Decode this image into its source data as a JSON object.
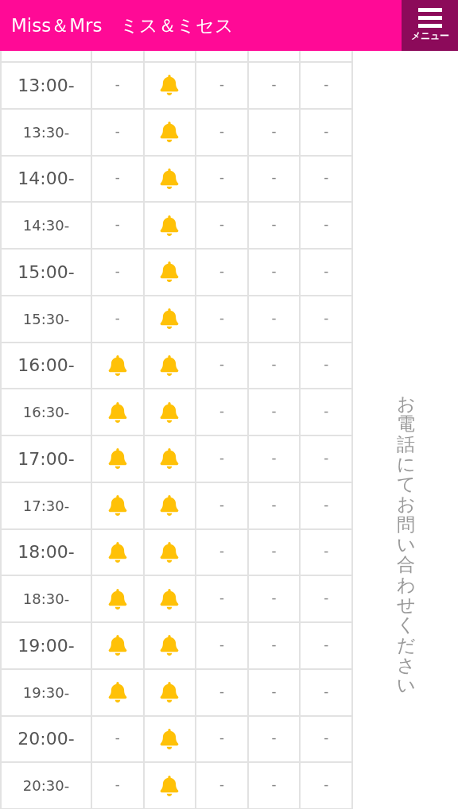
{
  "header": {
    "title": "Miss＆Mrs　ミス＆ミセス",
    "menu_label": "メニュー"
  },
  "schedule": {
    "note": "お電話にてお問い合わせください",
    "rows": [
      {
        "time": "13:00-",
        "kind": "hour",
        "cells": [
          {
            "kind": "dash",
            "text": "-"
          },
          {
            "kind": "bell"
          },
          {
            "kind": "dash",
            "text": "-"
          },
          {
            "kind": "dash",
            "text": "-"
          },
          {
            "kind": "dash",
            "text": "-"
          }
        ]
      },
      {
        "time": "13:30-",
        "kind": "half",
        "cells": [
          {
            "kind": "dash",
            "text": "-"
          },
          {
            "kind": "bell"
          },
          {
            "kind": "dash",
            "text": "-"
          },
          {
            "kind": "dash",
            "text": "-"
          },
          {
            "kind": "dash",
            "text": "-"
          }
        ]
      },
      {
        "time": "14:00-",
        "kind": "hour",
        "cells": [
          {
            "kind": "dash",
            "text": "-"
          },
          {
            "kind": "bell"
          },
          {
            "kind": "dash",
            "text": "-"
          },
          {
            "kind": "dash",
            "text": "-"
          },
          {
            "kind": "dash",
            "text": "-"
          }
        ]
      },
      {
        "time": "14:30-",
        "kind": "half",
        "cells": [
          {
            "kind": "dash",
            "text": "-"
          },
          {
            "kind": "bell"
          },
          {
            "kind": "dash",
            "text": "-"
          },
          {
            "kind": "dash",
            "text": "-"
          },
          {
            "kind": "dash",
            "text": "-"
          }
        ]
      },
      {
        "time": "15:00-",
        "kind": "hour",
        "cells": [
          {
            "kind": "dash",
            "text": "-"
          },
          {
            "kind": "bell"
          },
          {
            "kind": "dash",
            "text": "-"
          },
          {
            "kind": "dash",
            "text": "-"
          },
          {
            "kind": "dash",
            "text": "-"
          }
        ]
      },
      {
        "time": "15:30-",
        "kind": "half",
        "cells": [
          {
            "kind": "dash",
            "text": "-"
          },
          {
            "kind": "bell"
          },
          {
            "kind": "dash",
            "text": "-"
          },
          {
            "kind": "dash",
            "text": "-"
          },
          {
            "kind": "dash",
            "text": "-"
          }
        ]
      },
      {
        "time": "16:00-",
        "kind": "hour",
        "cells": [
          {
            "kind": "bell"
          },
          {
            "kind": "bell"
          },
          {
            "kind": "dash",
            "text": "-"
          },
          {
            "kind": "dash",
            "text": "-"
          },
          {
            "kind": "dash",
            "text": "-"
          }
        ]
      },
      {
        "time": "16:30-",
        "kind": "half",
        "cells": [
          {
            "kind": "bell"
          },
          {
            "kind": "bell"
          },
          {
            "kind": "dash",
            "text": "-"
          },
          {
            "kind": "dash",
            "text": "-"
          },
          {
            "kind": "dash",
            "text": "-"
          }
        ]
      },
      {
        "time": "17:00-",
        "kind": "hour",
        "cells": [
          {
            "kind": "bell"
          },
          {
            "kind": "bell"
          },
          {
            "kind": "dash",
            "text": "-"
          },
          {
            "kind": "dash",
            "text": "-"
          },
          {
            "kind": "dash",
            "text": "-"
          }
        ]
      },
      {
        "time": "17:30-",
        "kind": "half",
        "cells": [
          {
            "kind": "bell"
          },
          {
            "kind": "bell"
          },
          {
            "kind": "dash",
            "text": "-"
          },
          {
            "kind": "dash",
            "text": "-"
          },
          {
            "kind": "dash",
            "text": "-"
          }
        ]
      },
      {
        "time": "18:00-",
        "kind": "hour",
        "cells": [
          {
            "kind": "bell"
          },
          {
            "kind": "bell"
          },
          {
            "kind": "dash",
            "text": "-"
          },
          {
            "kind": "dash",
            "text": "-"
          },
          {
            "kind": "dash",
            "text": "-"
          }
        ]
      },
      {
        "time": "18:30-",
        "kind": "half",
        "cells": [
          {
            "kind": "bell"
          },
          {
            "kind": "bell"
          },
          {
            "kind": "dash",
            "text": "-"
          },
          {
            "kind": "dash",
            "text": "-"
          },
          {
            "kind": "dash",
            "text": "-"
          }
        ]
      },
      {
        "time": "19:00-",
        "kind": "hour",
        "cells": [
          {
            "kind": "bell"
          },
          {
            "kind": "bell"
          },
          {
            "kind": "dash",
            "text": "-"
          },
          {
            "kind": "dash",
            "text": "-"
          },
          {
            "kind": "dash",
            "text": "-"
          }
        ]
      },
      {
        "time": "19:30-",
        "kind": "half",
        "cells": [
          {
            "kind": "bell"
          },
          {
            "kind": "bell"
          },
          {
            "kind": "dash",
            "text": "-"
          },
          {
            "kind": "dash",
            "text": "-"
          },
          {
            "kind": "dash",
            "text": "-"
          }
        ]
      },
      {
        "time": "20:00-",
        "kind": "hour",
        "cells": [
          {
            "kind": "dash",
            "text": "-"
          },
          {
            "kind": "bell"
          },
          {
            "kind": "dash",
            "text": "-"
          },
          {
            "kind": "dash",
            "text": "-"
          },
          {
            "kind": "dash",
            "text": "-"
          }
        ]
      },
      {
        "time": "20:30-",
        "kind": "half",
        "cells": [
          {
            "kind": "dash",
            "text": "-"
          },
          {
            "kind": "bell"
          },
          {
            "kind": "dash",
            "text": "-"
          },
          {
            "kind": "dash",
            "text": "-"
          },
          {
            "kind": "dash",
            "text": "-"
          }
        ]
      }
    ]
  }
}
